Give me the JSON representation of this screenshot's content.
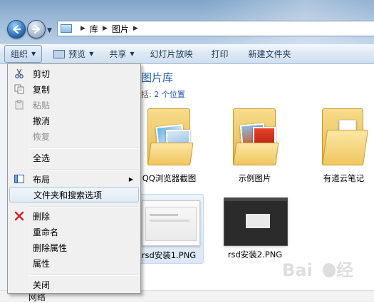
{
  "address": {
    "crumbs": [
      "库",
      "图片"
    ]
  },
  "toolbar": {
    "organize": "组织",
    "preview": "预览",
    "share": "共享",
    "slideshow": "幻灯片放映",
    "print": "打印",
    "new_folder": "新建文件夹"
  },
  "library": {
    "title": "图片库",
    "includes_label": "括:",
    "locations_link": "2 个位置"
  },
  "items": [
    {
      "label": "QQ浏览器截图",
      "icon": "folder-with-photos-icon"
    },
    {
      "label": "示例图片",
      "icon": "folder-with-photos-icon"
    },
    {
      "label": "有道云笔记",
      "icon": "folder-icon"
    },
    {
      "label": "rsd安装1.PNG",
      "icon": "image-thumbnail"
    },
    {
      "label": "rsd安装2.PNG",
      "icon": "image-thumbnail"
    }
  ],
  "context_menu": {
    "items": [
      {
        "label": "剪切",
        "icon": "scissors-icon",
        "enabled": true
      },
      {
        "label": "复制",
        "icon": "copy-icon",
        "enabled": true
      },
      {
        "label": "粘贴",
        "icon": "paste-icon",
        "enabled": false
      },
      {
        "label": "撤消",
        "enabled": true
      },
      {
        "label": "恢复",
        "enabled": false
      },
      {
        "label": "全选",
        "enabled": true
      },
      {
        "label": "布局",
        "icon": "layout-icon",
        "enabled": true,
        "submenu": true
      },
      {
        "label": "文件夹和搜索选项",
        "enabled": true,
        "highlighted": true
      },
      {
        "label": "删除",
        "icon": "delete-x-icon",
        "enabled": true
      },
      {
        "label": "重命名",
        "enabled": true
      },
      {
        "label": "删除属性",
        "enabled": true
      },
      {
        "label": "属性",
        "enabled": true
      },
      {
        "label": "关闭",
        "enabled": true
      }
    ]
  },
  "sidebar_partial": {
    "network_label": "网络"
  },
  "colors": {
    "accent_blue": "#1e5aa8",
    "menu_bg": "#f0f0f0",
    "highlight_border": "#a8c3e3",
    "delete_red": "#d21f1f"
  }
}
